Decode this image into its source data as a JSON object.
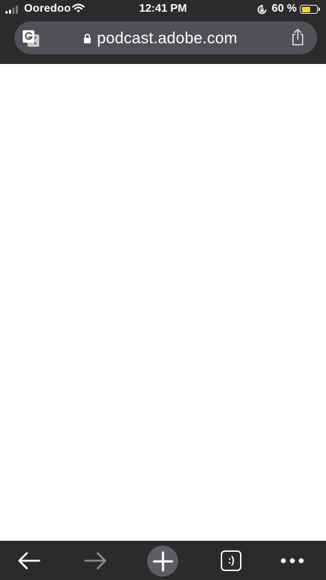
{
  "status_bar": {
    "carrier": "Ooredoo",
    "time": "12:41 PM",
    "battery_percent": "60 %",
    "battery_level": 0.6,
    "signal_bars": 2,
    "icons": [
      "signal-icon",
      "wifi-icon",
      "rotation-lock-icon",
      "battery-icon"
    ]
  },
  "browser": {
    "url": "podcast.adobe.com",
    "icons": [
      "translate-icon",
      "lock-icon",
      "share-icon"
    ]
  },
  "toolbar": {
    "tab_count_glyph": ":)",
    "icons": [
      "back-arrow-icon",
      "forward-arrow-icon",
      "plus-icon",
      "tab-switcher-icon",
      "more-dots-icon"
    ]
  },
  "colors": {
    "chrome_background": "#2b2b2d",
    "url_bar": "#505155",
    "new_tab_circle": "#5d5e62",
    "battery_fill": "#f5d33a",
    "disabled_icon": "#8a8a8d",
    "page_background": "#ffffff"
  }
}
